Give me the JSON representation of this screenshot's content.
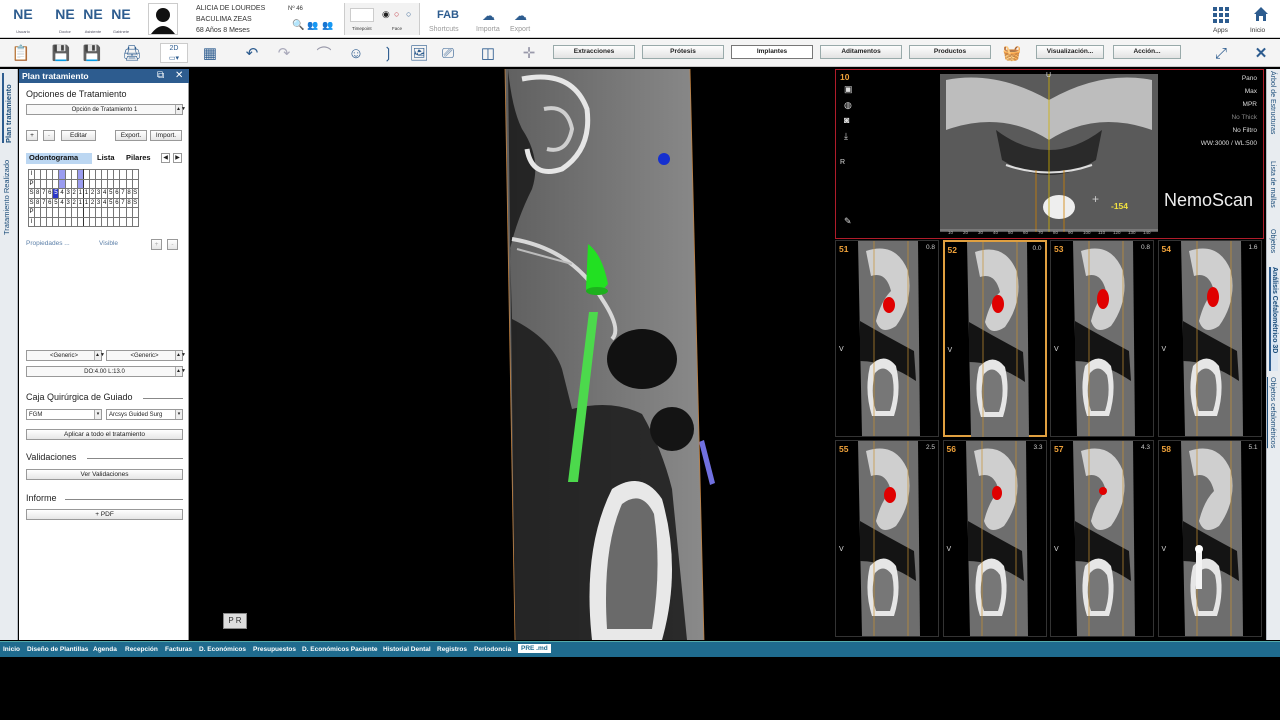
{
  "header": {
    "logos": [
      {
        "text": "NE",
        "sub": "Usuario"
      },
      {
        "text": "NE",
        "sub": "Doctor"
      },
      {
        "text": "NE",
        "sub": "Asistente"
      },
      {
        "text": "NE",
        "sub": "Gabinete"
      }
    ],
    "patient_name": "ALICIA DE LOURDES",
    "patient_surname": "BACULIMA ZEAS",
    "patient_age": "68 Años 8 Meses",
    "patient_no": "Nº 46",
    "timepoint_label": "Timepoint",
    "face_label": "Face",
    "fab_label": "FAB",
    "shortcuts_label": "Shortcuts",
    "import_label": "Importa",
    "export_label": "Export",
    "apps_label": "Apps",
    "home_label": "Inicio"
  },
  "toolbar": {
    "view_2d": "2D",
    "buttons": [
      "Extracciones",
      "Prótesis",
      "Implantes",
      "Aditamentos",
      "Productos"
    ],
    "active_button": "Implantes",
    "visualizacion": "Visualización...",
    "accion": "Acción..."
  },
  "left_tabs": [
    "Plan tratamiento",
    "Tratamiento Realizado"
  ],
  "panel": {
    "title": "Plan tratamiento",
    "options_title": "Opciones de Tratamiento",
    "option_selected": "Opción de Tratamiento 1",
    "plus": "+",
    "minus": "-",
    "edit": "Editar",
    "export": "Export.",
    "import": "Import.",
    "tabs": [
      "Odontograma",
      "Lista",
      "Pilares"
    ],
    "odontogram_rows": [
      [
        "I",
        "",
        "",
        "",
        "",
        "",
        "",
        "",
        "",
        "",
        "",
        "",
        "",
        "",
        "",
        "",
        "",
        "",
        "I"
      ],
      [
        "P",
        "",
        "",
        "",
        "",
        "",
        "",
        "",
        "",
        "",
        "",
        "",
        "",
        "",
        "",
        "",
        "",
        "",
        "P"
      ],
      [
        "S",
        "8",
        "7",
        "6",
        "5",
        "4",
        "3",
        "2",
        "1",
        "1",
        "2",
        "3",
        "4",
        "5",
        "6",
        "7",
        "8",
        "S"
      ],
      [
        "S",
        "8",
        "7",
        "6",
        "5",
        "4",
        "3",
        "2",
        "1",
        "1",
        "2",
        "3",
        "4",
        "5",
        "6",
        "7",
        "8",
        "S"
      ],
      [
        "P",
        "",
        "",
        "",
        "",
        "",
        "",
        "",
        "",
        "",
        "",
        "",
        "",
        "",
        "",
        "",
        "",
        "",
        "P"
      ],
      [
        "I",
        "",
        "",
        "",
        "",
        "",
        "",
        "",
        "",
        "",
        "",
        "",
        "",
        "",
        "",
        "",
        "",
        "",
        "I"
      ]
    ],
    "properties_label": "Propiedades ...",
    "visible_label": "Visible",
    "generic_1": "<Generic>",
    "generic_2": "<Generic>",
    "implant_dims": "DO:4.00 L:13.0",
    "guide_title": "Caja Quirúrgica de Guiado",
    "guide_brand": "FGM",
    "guide_kit": "Arcsys Guided Surg",
    "apply_all": "Aplicar a todo el tratamiento",
    "validations_title": "Validaciones",
    "see_validations": "Ver Validaciones",
    "report_title": "Informe",
    "pdf": "+ PDF"
  },
  "main_viewer": {
    "orientation_label": "P R"
  },
  "top_right_viewer": {
    "slice": "10",
    "label_u": "U",
    "label_r": "R",
    "mode_lines": [
      "Pano",
      "Max",
      "MPR",
      "No Thick",
      "No Filtro",
      "WW:3000 / WL:500"
    ],
    "cursor_value": "-154",
    "brand": "NemoScan",
    "ruler": [
      "10",
      "20",
      "30",
      "40",
      "50",
      "60",
      "70",
      "80",
      "90",
      "100",
      "110",
      "120",
      "130",
      "140"
    ]
  },
  "tiles": [
    {
      "num": "51",
      "val": "0.8"
    },
    {
      "num": "52",
      "val": "0.0"
    },
    {
      "num": "53",
      "val": "0.8"
    },
    {
      "num": "54",
      "val": "1.6"
    },
    {
      "num": "55",
      "val": "2.5"
    },
    {
      "num": "56",
      "val": "3.3"
    },
    {
      "num": "57",
      "val": "4.3"
    },
    {
      "num": "58",
      "val": "5.1"
    }
  ],
  "tile_v": "V",
  "right_tabs": [
    "Árbol de Estructuras",
    "Lista de mallas",
    "Objetos",
    "Análisis Cefalométrico 3D",
    "Objetos cefalométricos"
  ],
  "bottom_tabs": [
    "Inicio",
    "Diseño de Plantillas",
    "Agenda",
    "Recepción",
    "Facturas",
    "D. Económicos",
    "Presupuestos",
    "D. Económicos Paciente",
    "Historial Dental",
    "Registros",
    "Periodoncia",
    "PRE .md"
  ],
  "colors": {
    "accent": "#2d5c8f",
    "highlight_border": "#e0a040",
    "active_frame": "#b01c2a",
    "implant": "#3fdc3f",
    "nerve": "#e00000",
    "bottombar": "#1f6b8e"
  }
}
